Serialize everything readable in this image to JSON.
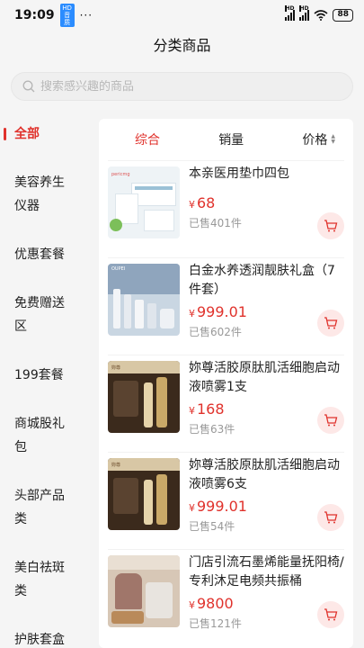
{
  "status_bar": {
    "time": "19:09",
    "badge": "HD 音质",
    "dots": "···",
    "network": "HD",
    "battery": "88"
  },
  "nav": {
    "title": "分类商品"
  },
  "search": {
    "placeholder": "搜索感兴趣的商品"
  },
  "categories": [
    {
      "label": "全部",
      "active": true
    },
    {
      "label": "美容养生仪器"
    },
    {
      "label": "优惠套餐"
    },
    {
      "label": "免费赠送区"
    },
    {
      "label": "199套餐"
    },
    {
      "label": "商城股礼包"
    },
    {
      "label": "头部产品类"
    },
    {
      "label": "美白祛斑类"
    },
    {
      "label": "护肤套盒"
    }
  ],
  "sort": {
    "comprehensive": "综合",
    "sales": "销量",
    "price": "价格"
  },
  "products": [
    {
      "name": "本亲医用垫巾四包",
      "currency": "¥",
      "price": "68",
      "sold": "已售401件"
    },
    {
      "name": "白金水养透润靓肤礼盒（7件套）",
      "currency": "¥",
      "price": "999.01",
      "sold": "已售602件"
    },
    {
      "name": "妳尊活胶原肽肌活细胞启动液喷雾1支",
      "currency": "¥",
      "price": "168",
      "sold": "已售63件"
    },
    {
      "name": "妳尊活胶原肽肌活细胞启动液喷雾6支",
      "currency": "¥",
      "price": "999.01",
      "sold": "已售54件"
    },
    {
      "name": "门店引流石墨烯能量抚阳椅/专利沐足电频共振桶",
      "currency": "¥",
      "price": "9800",
      "sold": "已售121件"
    }
  ],
  "colors": {
    "accent": "#e0322c",
    "cart_bg": "#fde8e7"
  },
  "icons": {
    "search": "search-icon",
    "cart": "cart-icon",
    "sort": "sort-arrows-icon"
  }
}
